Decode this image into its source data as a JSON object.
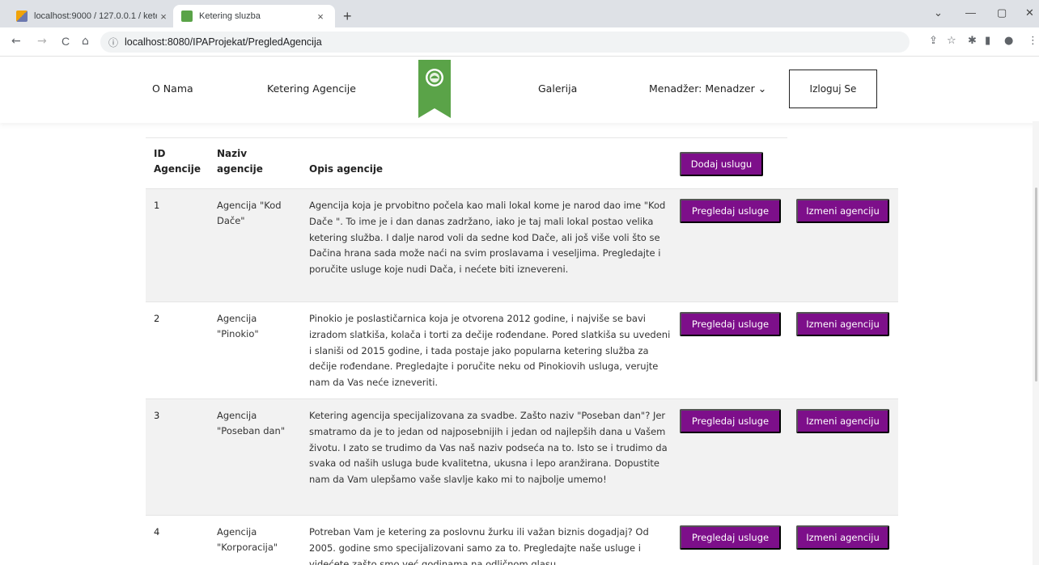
{
  "browser": {
    "tabs": [
      {
        "title": "localhost:9000 / 127.0.0.1 / keter",
        "close": "×"
      },
      {
        "title": "Ketering sluzba",
        "close": "×"
      }
    ],
    "new_tab": "+",
    "window_controls": {
      "minimize": "—",
      "maximize": "▢",
      "close": "✕",
      "dropdown": "⌄"
    },
    "nav": {
      "back": "←",
      "forward": "→",
      "reload": "C",
      "home": "⌂"
    },
    "url_info": "ⓘ",
    "url": "localhost:8080/IPAProjekat/PregledAgencija",
    "toolbar_icons": {
      "share": "⇪",
      "star": "☆",
      "extensions": "✱",
      "sidebar": "▮",
      "profile": "●",
      "menu": "⋮"
    }
  },
  "site": {
    "nav": {
      "about": "O Nama",
      "agencies": "Ketering Agencije",
      "gallery": "Galerija",
      "manager": "Menadžer: Menadzer ⌄",
      "logout": "Izloguj Se"
    }
  },
  "table": {
    "headers": {
      "id_line1": "ID",
      "id_line2": "Agencije",
      "name_line1": "Naziv",
      "name_line2": "agencije",
      "desc": "Opis agencije"
    },
    "add_button": "Dodaj uslugu",
    "view_button": "Pregledaj usluge",
    "edit_button": "Izmeni agenciju",
    "rows": [
      {
        "id": "1",
        "name": "Agencija \"Kod Dače\"",
        "description": "Agencija koja je prvobitno počela kao mali lokal kome je narod dao ime \"Kod Dače \". To ime je i dan danas zadržano, iako je taj mali lokal postao velika ketering služba. I dalje narod voli da sedne kod Dače, ali još više voli što se Dačina hrana sada može naći na svim proslavama i veseljima. Pregledajte i poručite usluge koje nudi Dača, i nećete biti iznevereni."
      },
      {
        "id": "2",
        "name": "Agencija \"Pinokio\"",
        "description": "Pinokio je poslastičarnica koja je otvorena 2012 godine, i najviše se bavi izradom slatkiša, kolača i torti za dečije rođendane. Pored slatkiša su uvedeni i slaniši od 2015 godine, i tada postaje jako popularna ketering služba za dečije rođendane. Pregledajte i poručite neku od Pinokiovih usluga, verujte nam da Vas neće izneveriti."
      },
      {
        "id": "3",
        "name": "Agencija \"Poseban dan\"",
        "description": "Ketering agencija specijalizovana za svadbe. Zašto naziv \"Poseban dan\"? Jer smatramo da je to jedan od najposebnijih i jedan od najlepših dana u Vašem životu. I zato se trudimo da Vas naš naziv podseća na to. Isto se i trudimo da svaka od naših usluga bude kvalitetna, ukusna i lepo aranžirana. Dopustite nam da Vam ulepšamo vaše slavlje kako mi to najbolje umemo!"
      },
      {
        "id": "4",
        "name": "Agencija \"Korporacija\"",
        "description": "Potreban Vam je ketering za poslovnu žurku ili važan biznis dogadjaj? Od 2005. godine smo specijalizovani samo za to. Pregledajte naše usluge i videćete zašto smo već godinama na odličnom glasu."
      }
    ]
  },
  "colors": {
    "accent": "#7d0f8a",
    "logo_green": "#5aa348",
    "row_stripe": "#f2f2f2"
  }
}
